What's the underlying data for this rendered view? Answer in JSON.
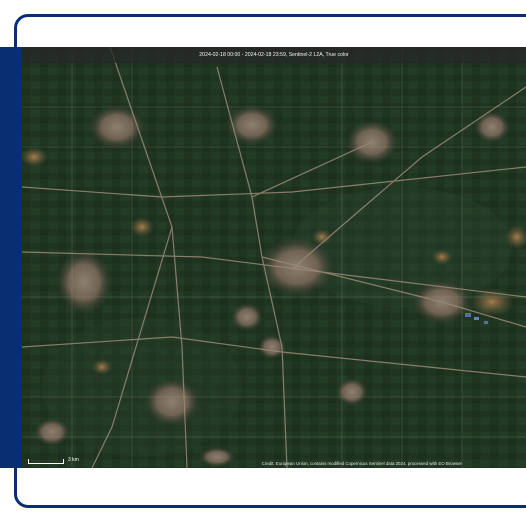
{
  "map": {
    "title": "2024-02-18 00:00 - 2024-02-18 23:59, Sentinel-2 L2A, True color",
    "scale_label": "3 km",
    "credit": "Credit: European Union, contains modified Copernicus Sentinel data 2024, processed with EO Browser"
  },
  "colors": {
    "frame": "#0a2e72",
    "fields": "#1f3422",
    "urban": "#7a6a5c",
    "roads": "#9a8a78"
  }
}
